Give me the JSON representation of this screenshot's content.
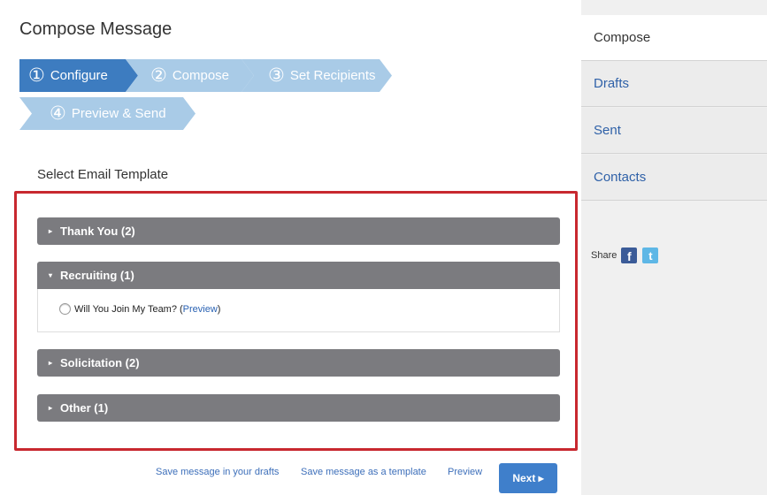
{
  "page_title": "Compose Message",
  "steps": [
    {
      "num": "①",
      "label": "Configure",
      "state": "active"
    },
    {
      "num": "②",
      "label": "Compose",
      "state": "inactive"
    },
    {
      "num": "③",
      "label": "Set Recipients",
      "state": "inactive"
    },
    {
      "num": "④",
      "label": "Preview & Send",
      "state": "inactive"
    }
  ],
  "template_section": {
    "label": "Select Email Template",
    "groups": [
      {
        "label": "Thank You (2)",
        "expanded": false,
        "caret": "▸"
      },
      {
        "label": "Recruiting (1)",
        "expanded": true,
        "caret": "▾",
        "items": [
          {
            "text": "Will You Join My Team?",
            "open_paren": "(",
            "link": "Preview",
            "close_paren": ")"
          }
        ]
      },
      {
        "label": "Solicitation (2)",
        "expanded": false,
        "caret": "▸"
      },
      {
        "label": "Other (1)",
        "expanded": false,
        "caret": "▸"
      }
    ]
  },
  "actions": {
    "save_drafts": "Save message in your drafts",
    "save_template": "Save message as a template",
    "preview": "Preview",
    "next": "Next ▸"
  },
  "sidebar": {
    "items": [
      {
        "label": "Compose",
        "selected": true
      },
      {
        "label": "Drafts",
        "selected": false
      },
      {
        "label": "Sent",
        "selected": false
      },
      {
        "label": "Contacts",
        "selected": false
      }
    ],
    "share_label": "Share",
    "facebook_glyph": "f",
    "twitter_glyph": "t"
  },
  "colors": {
    "step_active": "#3d7cc0",
    "step_inactive": "#a9cbe7",
    "accordion_header": "#7b7b7f",
    "highlight_box": "#c8282f",
    "link": "#2f61a8",
    "next_button": "#3f7fcb"
  }
}
